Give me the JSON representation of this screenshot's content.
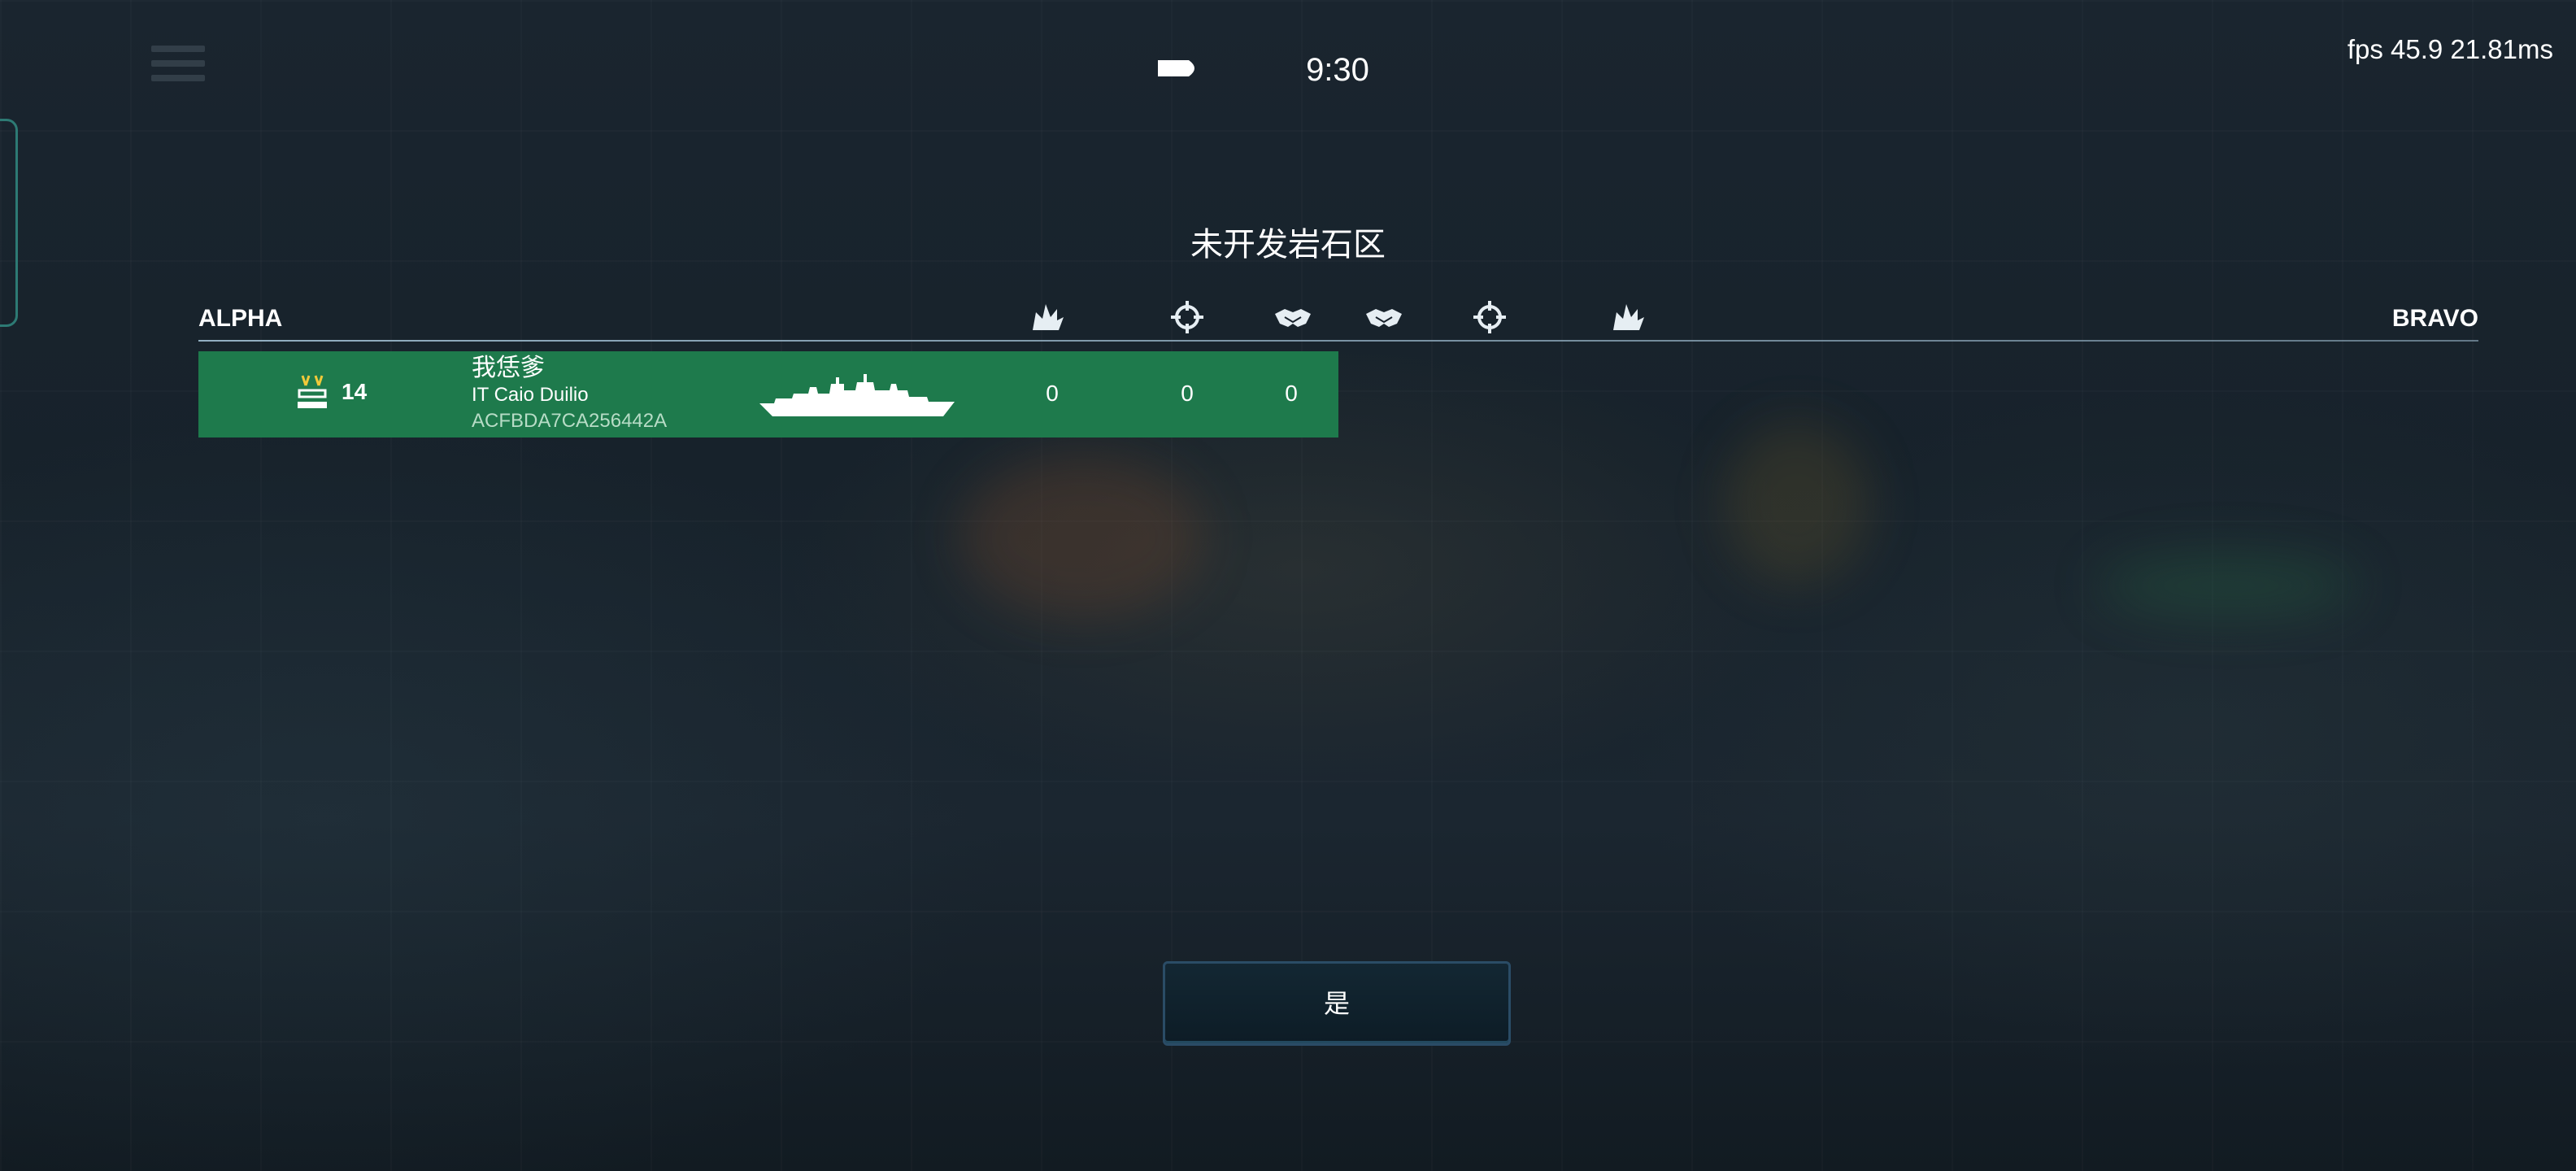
{
  "hud": {
    "timer": "9:30",
    "fps_text": "fps 45.9  21.81ms"
  },
  "scoreboard": {
    "map_name": "未开发岩石区",
    "team_alpha": "ALPHA",
    "team_bravo": "BRAVO",
    "column_icons": [
      "damage-icon",
      "crosshair-icon",
      "assist-icon",
      "assist-icon",
      "crosshair-icon",
      "damage-icon"
    ],
    "players": [
      {
        "rank": "14",
        "player_name": "我恁爹",
        "ship_name": "IT Caio Duilio",
        "player_id": "ACFBDA7CA256442A",
        "stat_damage": "0",
        "stat_kills": "0",
        "stat_assists": "0"
      }
    ]
  },
  "buttons": {
    "confirm_label": "是"
  },
  "colors": {
    "alpha_row": "#1e7a4c",
    "header_line": "#a0bed2",
    "button_border": "#2a4c66"
  }
}
